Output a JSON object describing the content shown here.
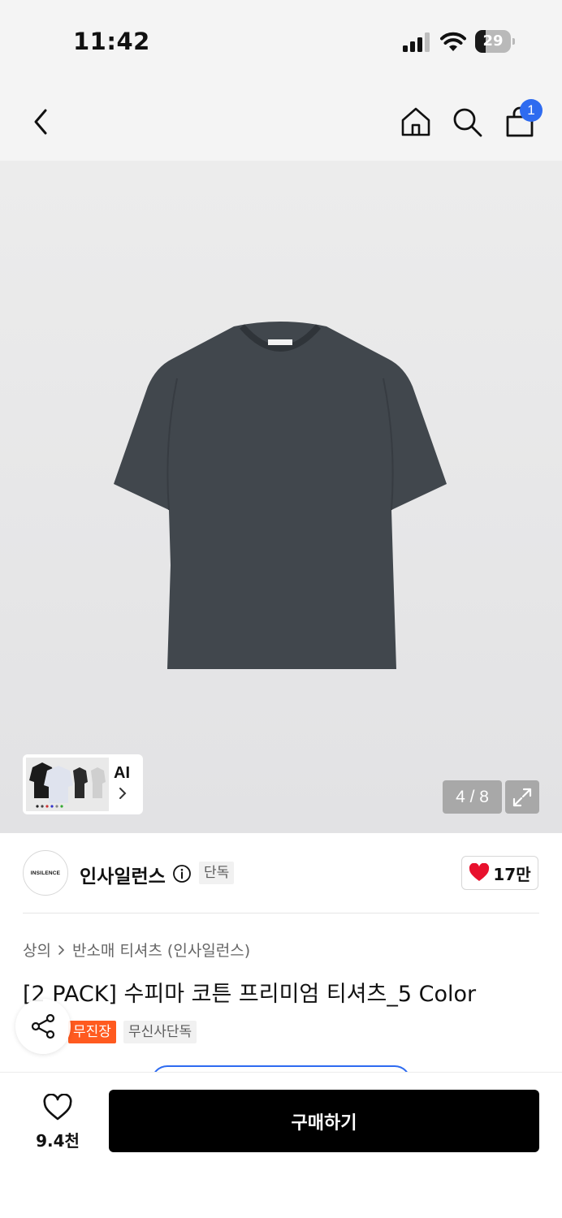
{
  "status_bar": {
    "time": "11:42",
    "battery_percent": "29",
    "battery_level": 0.29,
    "signal_icon": "cellular-signal-icon",
    "wifi_icon": "wifi-icon"
  },
  "nav": {
    "back_icon": "chevron-left-icon",
    "home_icon": "home-icon",
    "search_icon": "search-icon",
    "cart_icon": "shopping-bag-icon",
    "cart_badge": "1",
    "badge_color": "#2e6bf0"
  },
  "gallery": {
    "counter": "4 / 8",
    "ai_label": "AI",
    "expand_icon": "expand-icon",
    "shirt_color": "#41474d"
  },
  "brand": {
    "logo_text": "INSILENCE",
    "name": "인사일런스",
    "exclusive_tag": "단독",
    "like_count": "17만",
    "like_color": "#e8112d"
  },
  "breadcrumb": {
    "category": "상의",
    "subcategory": "반소매 티셔츠 (인사일런스)"
  },
  "product": {
    "title": "[2 PACK] 수피마 코튼 프리미엄 티셔츠_5 Color",
    "tags": [
      "무진장",
      "무신사단독"
    ],
    "tag_accent": "#ff5a1f"
  },
  "bottom_bar": {
    "wish_count": "9.4천",
    "buy_label": "구매하기"
  }
}
